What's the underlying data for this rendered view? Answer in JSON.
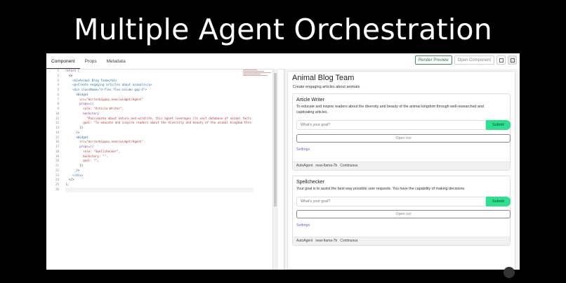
{
  "slide": {
    "title": "Multiple Agent Orchestration"
  },
  "tabs": [
    "Component",
    "Props",
    "Metadata"
  ],
  "toolbar": {
    "render": "Render Preview",
    "open": "Open Component"
  },
  "editor": {
    "lines": [
      "return (",
      "  <>",
      "    <h2>Animal Blog Team</h2>",
      "    <p>Create engaging articles about animals</p>",
      "    <div className=\"d-flex flex-column gap-4\">",
      "      <Widget",
      "        src=\"mirrorbippou.near/widget/Agent\"",
      "        props={{",
      "          role: \"Article Writer\",",
      "          backstory:",
      "            \"Passionate about nature and wildlife, this agent leverages its vast database of animal facts",
      "          goal: \"To educate and inspire readers about the diversity and beauty of the animal kingdom thro",
      "        }}",
      "      />",
      "      <Widget",
      "        src=\"mirrorbippou.near/widget/Agent\"",
      "        props={{",
      "          role: \"Spellchecker\",",
      "          backstory: \"\",",
      "          goal: \"\",",
      "        }}",
      "      />",
      "    </div>",
      "  </>",
      ");",
      ""
    ]
  },
  "preview": {
    "title": "Animal Blog Team",
    "description": "Create engaging articles about animals",
    "agents": [
      {
        "name": "Article Writer",
        "description": "To educate and inspire readers about the diversity and beauty of the animal kingdom through well-researched and captivating articles.",
        "placeholder": "What's your goal?",
        "submit": "Submit",
        "open_run": "Open run",
        "settings": "Settings",
        "footer": [
          "AutoAgent",
          "near-llama-7b",
          "Continuous"
        ]
      },
      {
        "name": "Spellchecker",
        "description": "Your goal is to assist the best way possible user requests. You have the capability of making decisions",
        "placeholder": "What's your goal?",
        "submit": "Submit",
        "open_run": "Open run",
        "settings": "Settings",
        "footer": [
          "AutoAgent",
          "near-llama-7b",
          "Continuous"
        ]
      }
    ]
  },
  "colors": {
    "submit": "#2ee08f",
    "settings_link": "#7a5cd0",
    "render_button": "#2e7d4f"
  }
}
